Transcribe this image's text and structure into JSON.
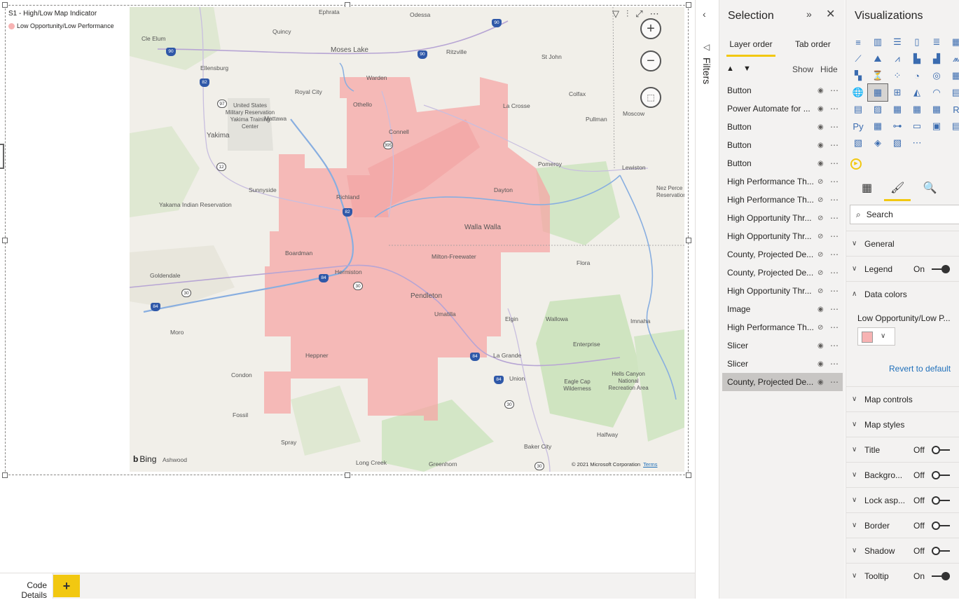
{
  "visual": {
    "legend_title": "S1 - High/Low Map Indicator",
    "legend_entry": "Low Opportunity/Low Performance",
    "legend_color": "#f7b3b3"
  },
  "map": {
    "labels": [
      "Ephrata",
      "Odessa",
      "Quincy",
      "Cle Elum",
      "Moses Lake",
      "Ritzville",
      "St John",
      "Warden",
      "Ellensburg",
      "Royal City",
      "Othello",
      "La Crosse",
      "Colfax",
      "Pullman",
      "Moscow",
      "Connell",
      "United States Military Reservation Yakima Training Center",
      "Mattawa",
      "Yakima",
      "Pomeroy",
      "Lewiston",
      "Sunnyside",
      "Richland",
      "Dayton",
      "Nez Perce Reservation",
      "Yakama Indian Reservation",
      "Walla Walla",
      "Milton-Freewater",
      "Flora",
      "Goldendale",
      "Boardman",
      "Hermiston",
      "Pendleton",
      "Umatilla",
      "Elgin",
      "Wallowa",
      "Imnaha",
      "Moro",
      "Heppner",
      "Enterprise",
      "La Grande",
      "Union",
      "Eagle Cap Wilderness",
      "Hells Canyon National Recreation Area",
      "Condon",
      "Fossil",
      "Spray",
      "Halfway",
      "Baker City",
      "Ashwood",
      "Long Creek",
      "Greenhorn"
    ],
    "zoom_in": "+",
    "zoom_out": "−",
    "bing": "Bing",
    "copyright": "© 2021 Microsoft Corporation",
    "terms": "Terms",
    "region_color": "#f6a3a3"
  },
  "pagebar": {
    "tab": "Code Details",
    "add": "+"
  },
  "filters": {
    "label": "Filters"
  },
  "selection": {
    "title": "Selection",
    "tab_layer": "Layer order",
    "tab_taborder": "Tab order",
    "show": "Show",
    "hide": "Hide",
    "items": [
      {
        "label": "Button",
        "hidden": false
      },
      {
        "label": "Power Automate for ...",
        "hidden": false
      },
      {
        "label": "Button",
        "hidden": false
      },
      {
        "label": "Button",
        "hidden": false
      },
      {
        "label": "Button",
        "hidden": false
      },
      {
        "label": "High Performance Th...",
        "hidden": true
      },
      {
        "label": "High Performance Th...",
        "hidden": true
      },
      {
        "label": "High Opportunity Thr...",
        "hidden": true
      },
      {
        "label": "High Opportunity Thr...",
        "hidden": true
      },
      {
        "label": "County, Projected De...",
        "hidden": true
      },
      {
        "label": "County, Projected De...",
        "hidden": true
      },
      {
        "label": "High Opportunity Thr...",
        "hidden": true
      },
      {
        "label": "Image",
        "hidden": false
      },
      {
        "label": "High Performance Th...",
        "hidden": true
      },
      {
        "label": "Slicer",
        "hidden": false
      },
      {
        "label": "Slicer",
        "hidden": false
      },
      {
        "label": "County, Projected De...",
        "hidden": false
      }
    ]
  },
  "viz": {
    "title": "Visualizations",
    "search_placeholder": "Search",
    "sections": {
      "general": "General",
      "legend": "Legend",
      "legend_state": "On",
      "data_colors": "Data colors",
      "data_color_label": "Low Opportunity/Low P...",
      "data_color_value": "#f7b3b3",
      "revert": "Revert to default",
      "map_controls": "Map controls",
      "map_styles": "Map styles",
      "title": "Title",
      "title_state": "Off",
      "background": "Backgro...",
      "background_state": "Off",
      "lock": "Lock asp...",
      "lock_state": "Off",
      "border": "Border",
      "border_state": "Off",
      "shadow": "Shadow",
      "shadow_state": "Off",
      "tooltip": "Tooltip",
      "tooltip_state": "On"
    }
  }
}
